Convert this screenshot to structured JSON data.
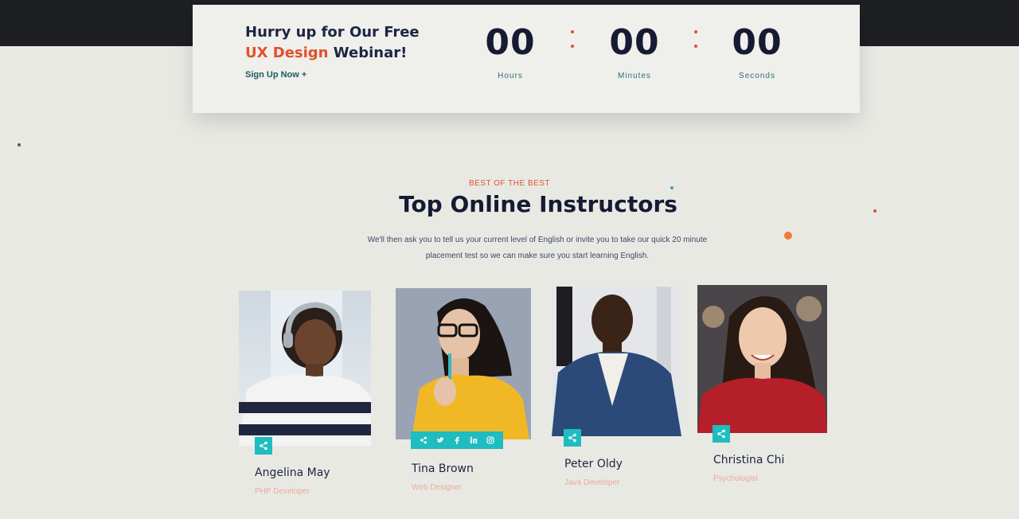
{
  "countdown": {
    "promo_line1": "Hurry up for Our Free",
    "promo_accent": "UX Design",
    "promo_rest": "Webinar!",
    "signup_link": "Sign Up Now +",
    "timers": [
      {
        "value": "00",
        "label": "Hours"
      },
      {
        "value": "00",
        "label": "Minutes"
      },
      {
        "value": "00",
        "label": "Seconds"
      }
    ],
    "separator": ":"
  },
  "section": {
    "eyebrow": "BEST OF THE BEST",
    "title": "Top Online Instructors",
    "description": "We'll then ask you to tell us your current level of English or invite you to take our quick 20 minute placement test so we can make sure you start learning English."
  },
  "instructors": [
    {
      "name": "Angelina May",
      "role": "PHP Developer"
    },
    {
      "name": "Tina Brown",
      "role": "Web Designer"
    },
    {
      "name": "Peter Oldy",
      "role": "Java Developer"
    },
    {
      "name": "Christina Chi",
      "role": "Psychologist"
    }
  ],
  "icons": {
    "share": "share-icon",
    "social": [
      "share-icon",
      "twitter-icon",
      "facebook-icon",
      "linkedin-icon",
      "instagram-icon"
    ]
  },
  "colors": {
    "accent": "#e2512b",
    "teal": "#1fbcc0",
    "navy": "#161b33"
  }
}
